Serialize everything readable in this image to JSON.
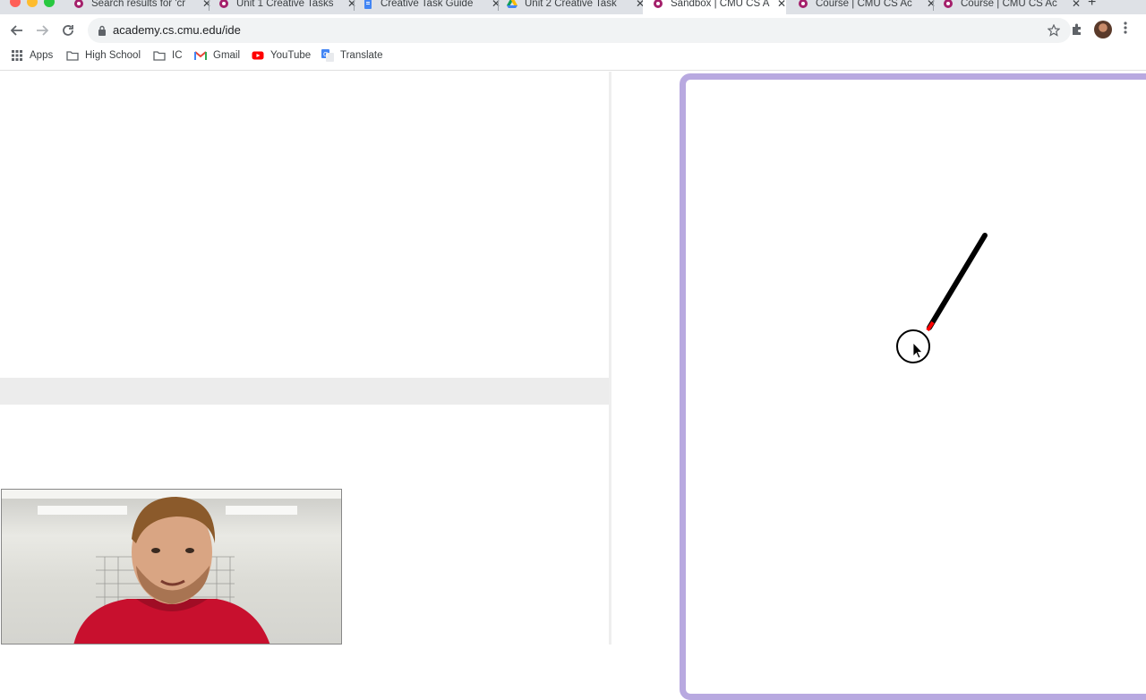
{
  "browser": {
    "tabs": [
      {
        "title": "Search results for 'cr",
        "favicon": "cmu-academy-icon",
        "active": false
      },
      {
        "title": "Unit 1 Creative Tasks",
        "favicon": "cmu-academy-icon",
        "active": false
      },
      {
        "title": "Creative Task Guide",
        "favicon": "google-docs-icon",
        "active": false
      },
      {
        "title": "Unit 2 Creative Task",
        "favicon": "google-drive-icon",
        "active": false
      },
      {
        "title": "Sandbox | CMU CS A",
        "favicon": "cmu-academy-icon",
        "active": true
      },
      {
        "title": "Course | CMU CS Ac",
        "favicon": "cmu-academy-icon",
        "active": false
      },
      {
        "title": "Course | CMU CS Ac",
        "favicon": "cmu-academy-icon",
        "active": false
      }
    ],
    "close_glyph": "✕",
    "new_tab_glyph": "+",
    "url": "academy.cs.cmu.edu/ide",
    "bookmarks": [
      {
        "label": "Apps",
        "icon": "apps-grid-icon"
      },
      {
        "label": "High School",
        "icon": "folder-icon"
      },
      {
        "label": "IC",
        "icon": "folder-icon"
      },
      {
        "label": "Gmail",
        "icon": "gmail-icon"
      },
      {
        "label": "YouTube",
        "icon": "youtube-icon"
      },
      {
        "label": "Translate",
        "icon": "translate-icon"
      }
    ]
  },
  "colors": {
    "canvas_border": "#b8a9e0",
    "line": "#000000",
    "line_tip": "#ff0000",
    "circle_stroke": "#000000"
  }
}
